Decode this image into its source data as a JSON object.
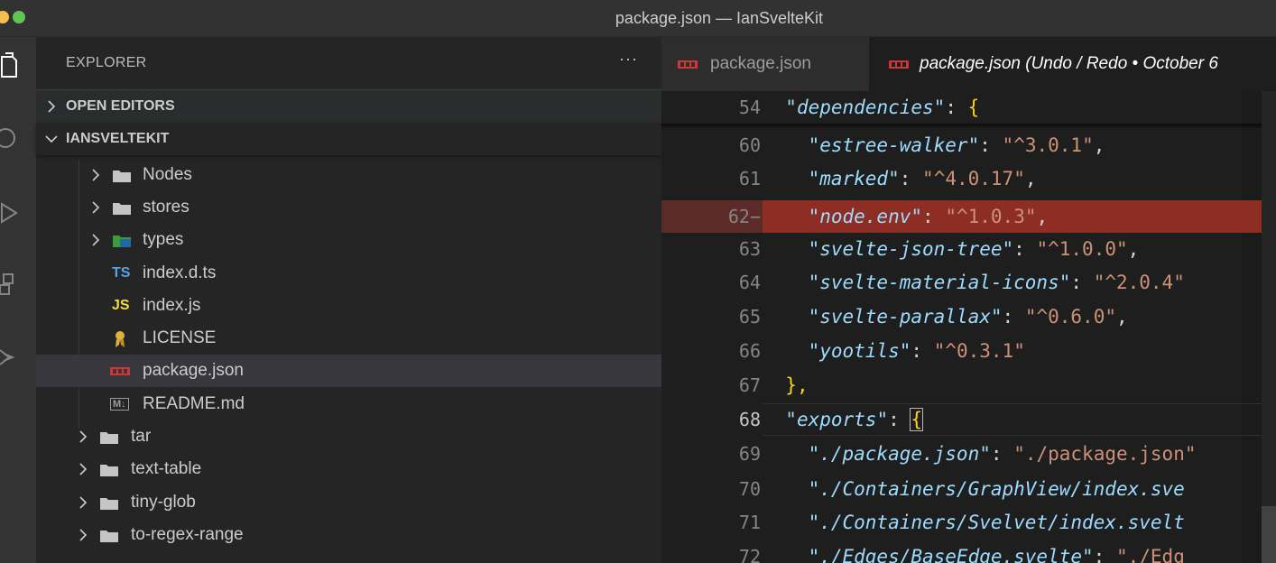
{
  "window": {
    "title": "package.json — IanSvelteKit"
  },
  "sidebar": {
    "header": "EXPLORER",
    "more": "···",
    "sections": {
      "open_editors": "OPEN EDITORS",
      "project": "IANSVELTEKIT"
    },
    "tree": [
      {
        "name": "Nodes",
        "kind": "folder"
      },
      {
        "name": "stores",
        "kind": "folder"
      },
      {
        "name": "types",
        "kind": "ts-folder",
        "icon": "TS"
      },
      {
        "name": "index.d.ts",
        "kind": "ts",
        "icon": "TS"
      },
      {
        "name": "index.js",
        "kind": "js",
        "icon": "JS"
      },
      {
        "name": "LICENSE",
        "kind": "license"
      },
      {
        "name": "package.json",
        "kind": "npm",
        "selected": true
      },
      {
        "name": "README.md",
        "kind": "md",
        "icon": "M↓"
      },
      {
        "name": "tar",
        "kind": "folder"
      },
      {
        "name": "text-table",
        "kind": "folder"
      },
      {
        "name": "tiny-glob",
        "kind": "folder"
      },
      {
        "name": "to-regex-range",
        "kind": "folder"
      }
    ]
  },
  "editor": {
    "tabs": [
      {
        "label": "package.json",
        "active": false
      },
      {
        "label": "package.json (Undo / Redo • October 6",
        "active": true
      }
    ],
    "lines": [
      {
        "num": "54",
        "key": "dependencies",
        "rest": ": {"
      },
      {
        "num": "60",
        "key": "estree-walker",
        "val": "^3.0.1",
        "comma": ","
      },
      {
        "num": "61",
        "key": "marked",
        "val": "^4.0.17",
        "comma": ","
      },
      {
        "num": "62−",
        "key": "node.env",
        "val": "^1.0.3",
        "comma": ","
      },
      {
        "num": "63",
        "key": "svelte-json-tree",
        "val": "^1.0.0",
        "comma": ","
      },
      {
        "num": "64",
        "key": "svelte-material-icons",
        "val": "^2.0.4",
        "comma": ""
      },
      {
        "num": "65",
        "key": "svelte-parallax",
        "val": "^0.6.0",
        "comma": ","
      },
      {
        "num": "66",
        "key": "yootils",
        "val": "^0.3.1",
        "comma": ""
      },
      {
        "num": "67",
        "text": "},"
      },
      {
        "num": "68",
        "key": "exports",
        "rest": ": {"
      },
      {
        "num": "69",
        "key": "./package.json",
        "val": "./package.json"
      },
      {
        "num": "70",
        "key": "./Containers/GraphView/index.sve"
      },
      {
        "num": "71",
        "key": "./Containers/Svelvet/index.svelt"
      },
      {
        "num": "72",
        "key": "./Edges/BaseEdge.svelte",
        "val": "./Edg"
      }
    ]
  },
  "colors": {
    "deleted_line": "#8e2d24",
    "json_key": "#9cdcfe",
    "json_string": "#ce9178",
    "bracket": "#ffd700"
  }
}
